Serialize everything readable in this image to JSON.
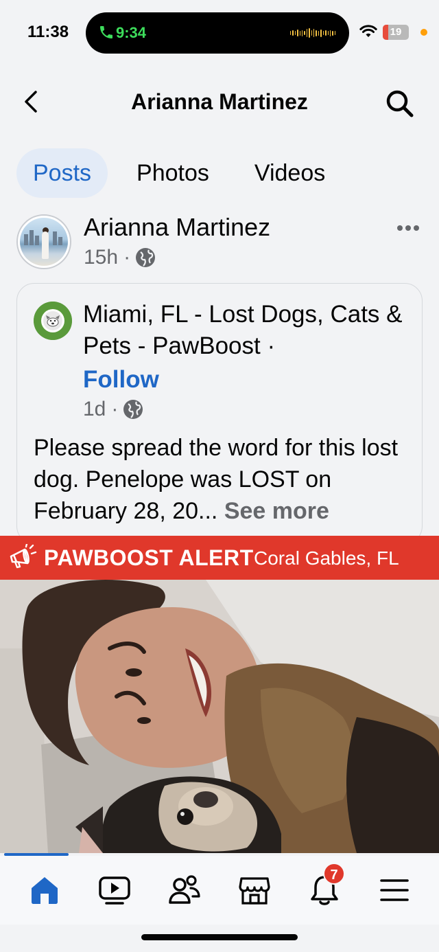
{
  "status_bar": {
    "time": "11:38",
    "call_time": "9:34",
    "battery": "19",
    "accent": "#3ddc5b"
  },
  "header": {
    "title": "Arianna Martinez",
    "back_icon": "chevron-left-icon",
    "search_icon": "search-icon"
  },
  "tabs": [
    {
      "label": "Posts",
      "active": true
    },
    {
      "label": "Photos",
      "active": false
    },
    {
      "label": "Videos",
      "active": false
    }
  ],
  "post": {
    "author": "Arianna Martinez",
    "time": "15h",
    "separator": "·",
    "audience_icon": "globe-icon",
    "more_icon": "more-horizontal-icon",
    "shared": {
      "page_name": "Miami, FL - Lost Dogs, Cats & Pets - PawBoost ·",
      "follow_label": "Follow",
      "time": "1d",
      "separator": "·",
      "text": "Please spread the word for this lost dog. Penelope was LOST on February 28, 20...",
      "see_more": "See more"
    },
    "alert": {
      "title": "PAWBOOST ALERT",
      "location": "Coral Gables, FL",
      "color": "#e0382b"
    }
  },
  "bottom_nav": {
    "items": [
      {
        "name": "home-icon",
        "active": true
      },
      {
        "name": "video-icon",
        "active": false
      },
      {
        "name": "friends-icon",
        "active": false
      },
      {
        "name": "marketplace-icon",
        "active": false
      },
      {
        "name": "notifications-icon",
        "active": false,
        "badge": "7"
      },
      {
        "name": "menu-icon",
        "active": false
      }
    ],
    "active_color": "#1f67c6"
  }
}
